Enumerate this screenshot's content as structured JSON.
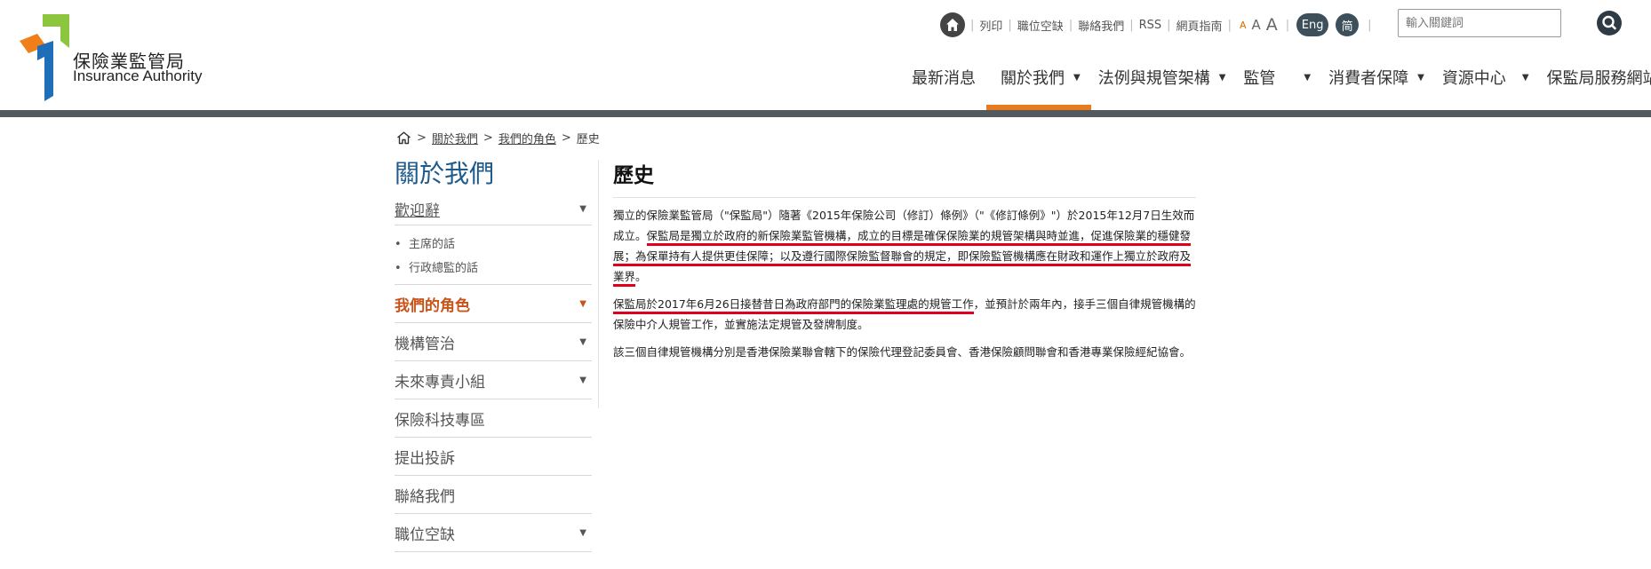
{
  "logo": {
    "name_zh": "保險業監管局",
    "name_en": "Insurance Authority"
  },
  "utility": {
    "links": [
      "列印",
      "職位空缺",
      "聯絡我們",
      "RSS",
      "網頁指南"
    ],
    "font_sizes": [
      "A",
      "A",
      "A"
    ],
    "lang_en": "Eng",
    "lang_sc": "简",
    "search_placeholder": "輸入關鍵詞"
  },
  "nav": {
    "items": [
      {
        "label": "最新消息",
        "has_dropdown": false,
        "active": false
      },
      {
        "label": "關於我們",
        "has_dropdown": true,
        "active": true
      },
      {
        "label": "法例與規管架構",
        "has_dropdown": true,
        "active": false
      },
      {
        "label": "監管",
        "has_dropdown": true,
        "active": false
      },
      {
        "label": "消費者保障",
        "has_dropdown": true,
        "active": false
      },
      {
        "label": "資源中心",
        "has_dropdown": true,
        "active": false
      },
      {
        "label": "保監局服務網站",
        "has_dropdown": true,
        "active": false
      }
    ]
  },
  "breadcrumb": {
    "about": "關於我們",
    "role": "我們的角色",
    "current": "歷史",
    "sep": ">"
  },
  "sidebar": {
    "title": "關於我們",
    "welcome": "歡迎辭",
    "sub_items": [
      "主席的話",
      "行政總監的話"
    ],
    "role": "我們的角色",
    "items": [
      {
        "label": "機構管治",
        "has_dropdown": true
      },
      {
        "label": "未來專責小組",
        "has_dropdown": true
      },
      {
        "label": "保險科技專區",
        "has_dropdown": false
      },
      {
        "label": "提出投訴",
        "has_dropdown": false
      },
      {
        "label": "聯絡我們",
        "has_dropdown": false
      },
      {
        "label": "職位空缺",
        "has_dropdown": true
      }
    ]
  },
  "content": {
    "title": "歷史",
    "p1_a": "獨立的保險業監管局（\"保監局\"）隨著《2015年保險公司（修訂）條例》（\"《修訂條例》\"）於2015年12月7日生效而成立。",
    "p1_b": "保監局是獨立於政府的新保險業監管機構，成立的目標是確保保險業的規管架構與時並進，促進保險業的穩健發展；為保單持有人提供更佳保障；以及遵行國際保險監督聯會的規定，即保險監管機構應在財政和運作上獨立於政府及業界",
    "p1_c": "。",
    "p2_a": "保監局於2017年6月26日接替昔日為政府部門的保險業監理處的規管工作",
    "p2_b": "，並預計於兩年內，接手三個自律規管機構的保險中介人規管工作，並實施法定規管及發牌制度。",
    "p3": "該三個自律規管機構分別是香港保險業聯會轄下的保險代理登記委員會、香港保險顧問聯會和香港專業保險經紀協會。"
  },
  "colors": {
    "accent_orange": "#e87b1e",
    "sidebar_title_blue": "#1e5a8c",
    "active_sidebar": "#c8541a",
    "annotation_red": "#e0001b",
    "header_bar": "#525a60"
  }
}
